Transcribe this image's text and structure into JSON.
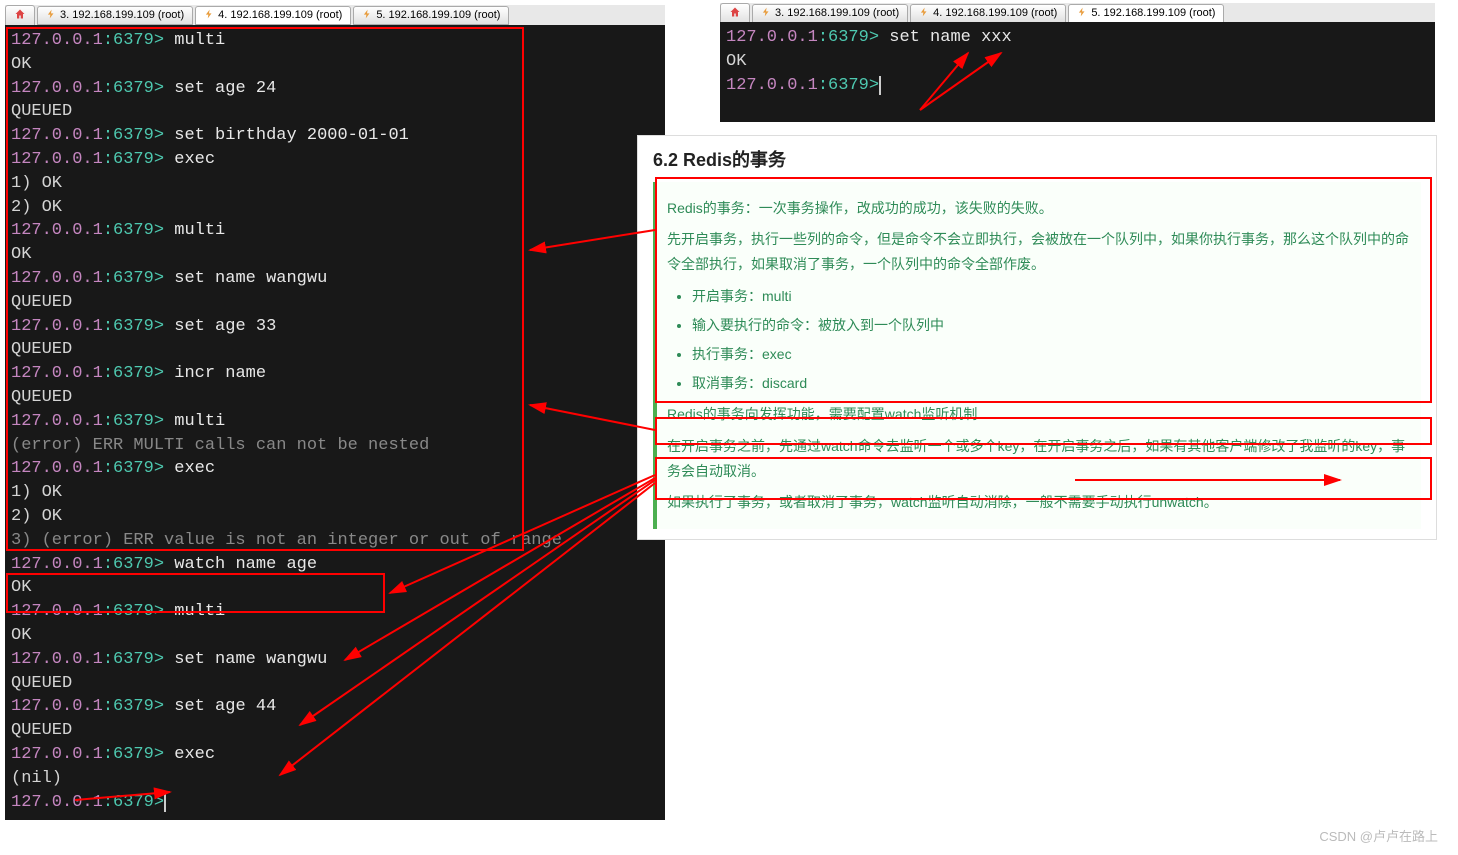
{
  "tabs1": [
    {
      "icon": "house",
      "label": ""
    },
    {
      "icon": "lightning",
      "label": "3. 192.168.199.109 (root)"
    },
    {
      "icon": "lightning",
      "label": "4. 192.168.199.109 (root)",
      "active": true
    },
    {
      "icon": "lightning",
      "label": "5. 192.168.199.109 (root)"
    }
  ],
  "tabs2": [
    {
      "icon": "house",
      "label": ""
    },
    {
      "icon": "lightning",
      "label": "3. 192.168.199.109 (root)"
    },
    {
      "icon": "lightning",
      "label": "4. 192.168.199.109 (root)"
    },
    {
      "icon": "lightning",
      "label": "5. 192.168.199.109 (root)",
      "active": true
    }
  ],
  "term1": {
    "lines": [
      {
        "type": "prompt",
        "ip": "127.0.0.1",
        "port": ":6379>",
        "cmd": "multi"
      },
      {
        "type": "out",
        "text": "OK"
      },
      {
        "type": "prompt",
        "ip": "127.0.0.1",
        "port": ":6379>",
        "cmd": "set age 24"
      },
      {
        "type": "out",
        "text": "QUEUED"
      },
      {
        "type": "prompt",
        "ip": "127.0.0.1",
        "port": ":6379>",
        "cmd": "set birthday 2000-01-01"
      },
      {
        "type": "prompt",
        "ip": "127.0.0.1",
        "port": ":6379>",
        "cmd": "exec"
      },
      {
        "type": "out",
        "text": "1) OK"
      },
      {
        "type": "out",
        "text": "2) OK"
      },
      {
        "type": "prompt",
        "ip": "127.0.0.1",
        "port": ":6379>",
        "cmd": "multi"
      },
      {
        "type": "out",
        "text": "OK"
      },
      {
        "type": "prompt",
        "ip": "127.0.0.1",
        "port": ":6379>",
        "cmd": "set name wangwu"
      },
      {
        "type": "out",
        "text": "QUEUED"
      },
      {
        "type": "prompt",
        "ip": "127.0.0.1",
        "port": ":6379>",
        "cmd": "set age 33"
      },
      {
        "type": "out",
        "text": "QUEUED"
      },
      {
        "type": "prompt",
        "ip": "127.0.0.1",
        "port": ":6379>",
        "cmd": "incr name"
      },
      {
        "type": "out",
        "text": "QUEUED"
      },
      {
        "type": "prompt",
        "ip": "127.0.0.1",
        "port": ":6379>",
        "cmd": "multi"
      },
      {
        "type": "err",
        "text": "(error) ERR MULTI calls can not be nested"
      },
      {
        "type": "prompt",
        "ip": "127.0.0.1",
        "port": ":6379>",
        "cmd": "exec"
      },
      {
        "type": "out",
        "text": "1) OK"
      },
      {
        "type": "out",
        "text": "2) OK"
      },
      {
        "type": "err",
        "text": "3) (error) ERR value is not an integer or out of range"
      },
      {
        "type": "prompt",
        "ip": "127.0.0.1",
        "port": ":6379>",
        "cmd": "watch name age"
      },
      {
        "type": "out",
        "text": "OK"
      },
      {
        "type": "prompt",
        "ip": "127.0.0.1",
        "port": ":6379>",
        "cmd": "multi"
      },
      {
        "type": "out",
        "text": "OK"
      },
      {
        "type": "prompt",
        "ip": "127.0.0.1",
        "port": ":6379>",
        "cmd": "set name wangwu"
      },
      {
        "type": "out",
        "text": "QUEUED"
      },
      {
        "type": "prompt",
        "ip": "127.0.0.1",
        "port": ":6379>",
        "cmd": "set age 44"
      },
      {
        "type": "out",
        "text": "QUEUED"
      },
      {
        "type": "prompt",
        "ip": "127.0.0.1",
        "port": ":6379>",
        "cmd": "exec"
      },
      {
        "type": "out",
        "text": "(nil)"
      },
      {
        "type": "prompt",
        "ip": "127.0.0.1",
        "port": ":6379>",
        "cmd": "",
        "cursor": true
      }
    ]
  },
  "term2": {
    "lines": [
      {
        "type": "prompt",
        "ip": "127.0.0.1",
        "port": ":6379>",
        "cmd": "set name xxx"
      },
      {
        "type": "out",
        "text": "OK"
      },
      {
        "type": "prompt",
        "ip": "127.0.0.1",
        "port": ":6379>",
        "cmd": "",
        "cursor": true
      }
    ]
  },
  "doc": {
    "title": "6.2 Redis的事务",
    "p1": "Redis的事务：一次事务操作，改成功的成功，该失败的失败。",
    "p2": "先开启事务，执行一些列的命令，但是命令不会立即执行，会被放在一个队列中，如果你执行事务，那么这个队列中的命令全部执行，如果取消了事务，一个队列中的命令全部作废。",
    "li1": "开启事务：multi",
    "li2": "输入要执行的命令：被放入到一个队列中",
    "li3": "执行事务：exec",
    "li4": "取消事务：discard",
    "p3": "Redis的事务向发挥功能，需要配置watch监听机制",
    "p4": "在开启事务之前，先通过watch命令去监听一个或多个key，在开启事务之后，如果有其他客户端修改了我监听的key，事务会自动取消。",
    "p5": "如果执行了事务，或者取消了事务，watch监听自动消除，一般不需要手动执行unwatch。"
  },
  "watermark": "CSDN @卢卢在路上"
}
